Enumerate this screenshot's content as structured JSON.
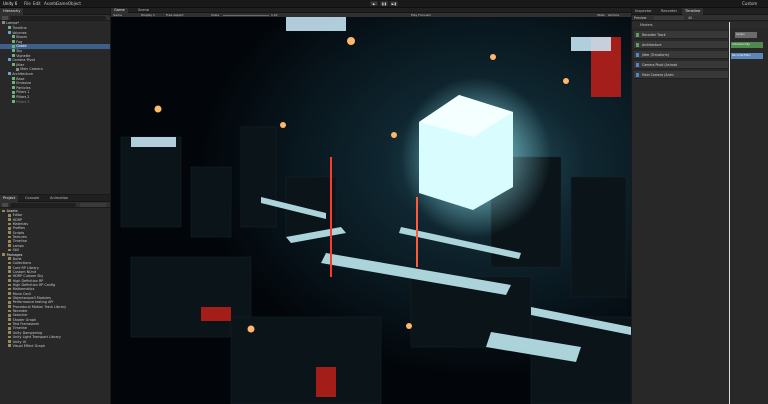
{
  "menubar": {
    "app": "Unity 6",
    "items": [
      "File",
      "Edit",
      "Assets",
      "GameObject",
      "Component",
      "Window",
      "Help"
    ],
    "layout": "Custom",
    "play_controls": [
      "▶",
      "❚❚",
      "▶❚"
    ]
  },
  "hierarchy": {
    "tab": "Hierarchy",
    "scene": "Lamps*",
    "items": [
      {
        "label": "Timeline",
        "indent": 2
      },
      {
        "label": "Volumes",
        "indent": 2
      },
      {
        "label": "Bloom",
        "indent": 3
      },
      {
        "label": "Fog",
        "indent": 3
      },
      {
        "label": "Grade",
        "indent": 3
      },
      {
        "label": "Sky",
        "indent": 3
      },
      {
        "label": "Vignette",
        "indent": 3
      },
      {
        "label": "Camera Pivot",
        "indent": 2
      },
      {
        "label": "Jitter",
        "indent": 3
      },
      {
        "label": "Main Camera",
        "indent": 4
      },
      {
        "label": "Architecture",
        "indent": 2
      },
      {
        "label": "Base",
        "indent": 3
      },
      {
        "label": "Emissive",
        "indent": 3
      },
      {
        "label": "Particles",
        "indent": 3
      },
      {
        "label": "Pillars 1",
        "indent": 3
      },
      {
        "label": "Pillars 2",
        "indent": 3
      },
      {
        "label": "Pillars 3",
        "indent": 3
      }
    ]
  },
  "gameview": {
    "tabs": [
      "Game",
      "Scene"
    ],
    "display": "Game",
    "display_select": "Display 1",
    "aspect": "Free Aspect",
    "scale_label": "Scale",
    "scale_value": "1.0x",
    "play_mode": "Play Focused",
    "right_items": [
      "Stats",
      "Gizmos"
    ]
  },
  "project": {
    "tabs": [
      "Project",
      "Console",
      "Animation"
    ],
    "assets_root": "Assets",
    "assets": [
      "Editor",
      "HDRP",
      "Materials",
      "Profiles",
      "Scripts",
      "Textures",
      "Timeline",
      "Lamps",
      "Still"
    ],
    "packages_root": "Packages",
    "packages": [
      "Burst",
      "Collections",
      "Core RP Library",
      "Custom NUnit",
      "HDRP Custom Sky",
      "High Definition RP",
      "High Definition RP Config",
      "Mathematics",
      "Mono Cecil",
      "Objectscope3 Modules",
      "Performance testing API",
      "Procedural Motion Track Library",
      "Recorder",
      "Searcher",
      "Shader Graph",
      "Test Framework",
      "Timeline",
      "Unity Dampening",
      "Unity Light Transport Library",
      "Unity UI",
      "Visual Effect Graph"
    ]
  },
  "timeline": {
    "tabs": [
      "Inspector",
      "Recorder",
      "Timeline"
    ],
    "preview": "Preview",
    "frame": "40",
    "markers": "Markers",
    "tracks": [
      {
        "label": "Recorder Track",
        "color": "#5aa05a"
      },
      {
        "label": "Architecture",
        "color": "#5aa05a"
      },
      {
        "label": "Jitter (Transform)",
        "color": "#4a88d4"
      },
      {
        "label": "Camera Pivot (Animat",
        "color": "#4a88d4"
      },
      {
        "label": "Main Camera (Anim",
        "color": "#4a88d4"
      }
    ],
    "clips": [
      "Lamps",
      "ActivationClip",
      "Recorder/Main"
    ]
  }
}
